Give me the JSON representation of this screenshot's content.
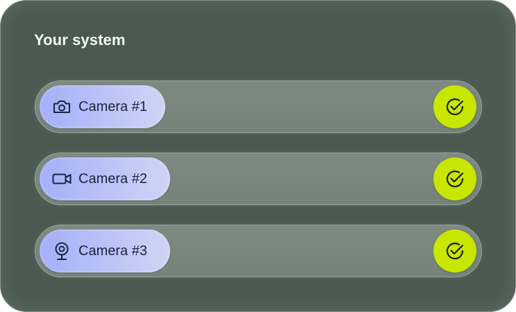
{
  "panel": {
    "title": "Your system"
  },
  "cameras": [
    {
      "label": "Camera #1",
      "icon": "camera-icon",
      "status_icon": "check-circle-icon"
    },
    {
      "label": "Camera #2",
      "icon": "video-camera-icon",
      "status_icon": "check-circle-icon"
    },
    {
      "label": "Camera #3",
      "icon": "webcam-icon",
      "status_icon": "check-circle-icon"
    }
  ],
  "colors": {
    "panel_bg": "#4a5a50",
    "chip": "#a5aef9",
    "check": "#c8e600",
    "text_dark": "#1b2240"
  }
}
